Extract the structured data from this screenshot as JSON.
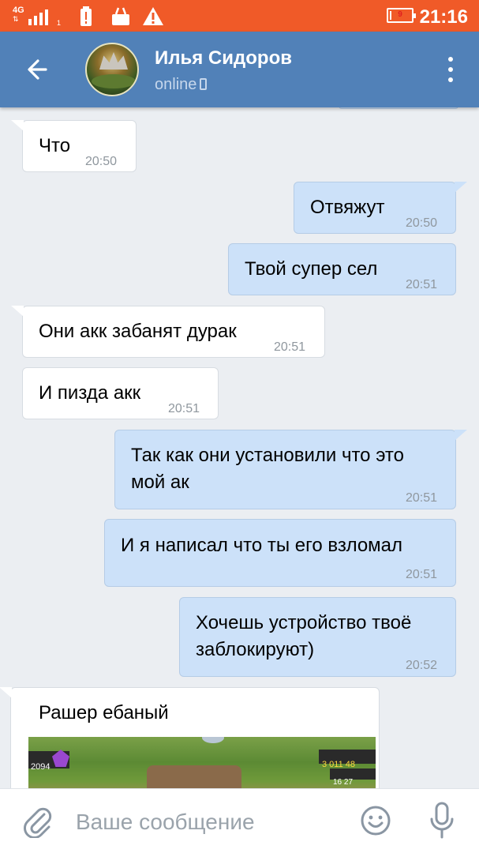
{
  "status_bar": {
    "network": "4G",
    "sim_slot": "1",
    "battery_level": "9",
    "battery_fraction": 0.09,
    "time": "21:16",
    "color": "#f05a28"
  },
  "header": {
    "contact_name": "Илья Сидоров",
    "status": "online",
    "status_icon": "phone-icon",
    "color": "#5181b8"
  },
  "messages": [
    {
      "direction": "in",
      "text": "Что",
      "time": "20:50"
    },
    {
      "direction": "out",
      "text": "Отвяжут",
      "time": "20:50"
    },
    {
      "direction": "out",
      "text": "Твой супер сел",
      "time": "20:51"
    },
    {
      "direction": "in",
      "text": "Они акк забанят дурак",
      "time": "20:51"
    },
    {
      "direction": "in",
      "text": "И пизда акк",
      "time": "20:51"
    },
    {
      "direction": "out",
      "text": "Так как они установили что это\nмой ак",
      "time": "20:51"
    },
    {
      "direction": "out",
      "text": "И я написал что ты его взломал",
      "time": "20:51"
    },
    {
      "direction": "out",
      "text": "Хочешь устройство твоё\nзаблокируют)",
      "time": "20:52"
    },
    {
      "direction": "in",
      "text": "Рашер ебаный",
      "time": "",
      "attachment": "game-screenshot-image"
    }
  ],
  "attachment_overlay": {
    "trophies": "2094",
    "gold": "3 011 48",
    "elixir": "16 27"
  },
  "input_bar": {
    "placeholder": "Ваше сообщение",
    "icons": [
      "paperclip-icon",
      "smile-icon",
      "microphone-icon"
    ]
  },
  "colors": {
    "incoming_bubble": "#ffffff",
    "outgoing_bubble": "#cce1f9",
    "background": "#ebeef2"
  }
}
